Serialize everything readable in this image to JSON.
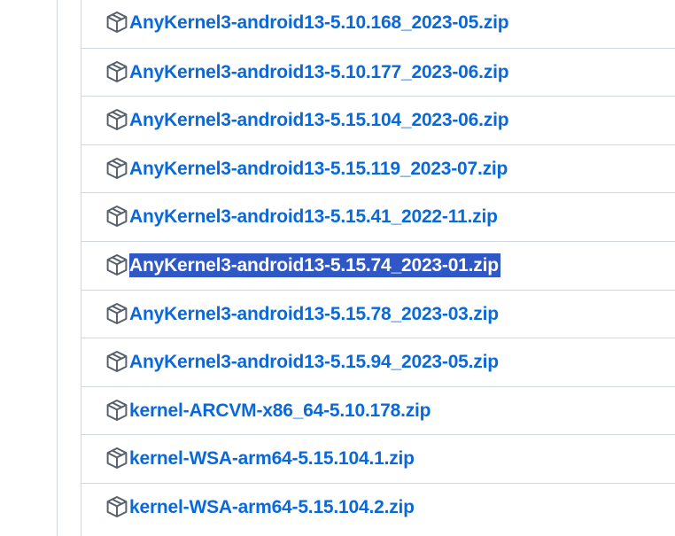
{
  "assets": {
    "items": [
      {
        "name": "AnyKernel3-android13-5.10.168_2023-05.zip",
        "icon": "package-icon",
        "selected": false
      },
      {
        "name": "AnyKernel3-android13-5.10.177_2023-06.zip",
        "icon": "package-icon",
        "selected": false
      },
      {
        "name": "AnyKernel3-android13-5.15.104_2023-06.zip",
        "icon": "package-icon",
        "selected": false
      },
      {
        "name": "AnyKernel3-android13-5.15.119_2023-07.zip",
        "icon": "package-icon",
        "selected": false
      },
      {
        "name": "AnyKernel3-android13-5.15.41_2022-11.zip",
        "icon": "package-icon",
        "selected": false
      },
      {
        "name": "AnyKernel3-android13-5.15.74_2023-01.zip",
        "icon": "package-icon",
        "selected": true
      },
      {
        "name": "AnyKernel3-android13-5.15.78_2023-03.zip",
        "icon": "package-icon",
        "selected": false
      },
      {
        "name": "AnyKernel3-android13-5.15.94_2023-05.zip",
        "icon": "package-icon",
        "selected": false
      },
      {
        "name": "kernel-ARCVM-x86_64-5.10.178.zip",
        "icon": "package-icon",
        "selected": false
      },
      {
        "name": "kernel-WSA-arm64-5.15.104.1.zip",
        "icon": "package-icon",
        "selected": false
      },
      {
        "name": "kernel-WSA-arm64-5.15.104.2.zip",
        "icon": "package-icon",
        "selected": false
      }
    ]
  },
  "colors": {
    "link": "#0969da",
    "selection_background": "#2f57c5",
    "selection_text": "#ffffff",
    "border": "#d0d7de",
    "icon": "#57606a"
  }
}
